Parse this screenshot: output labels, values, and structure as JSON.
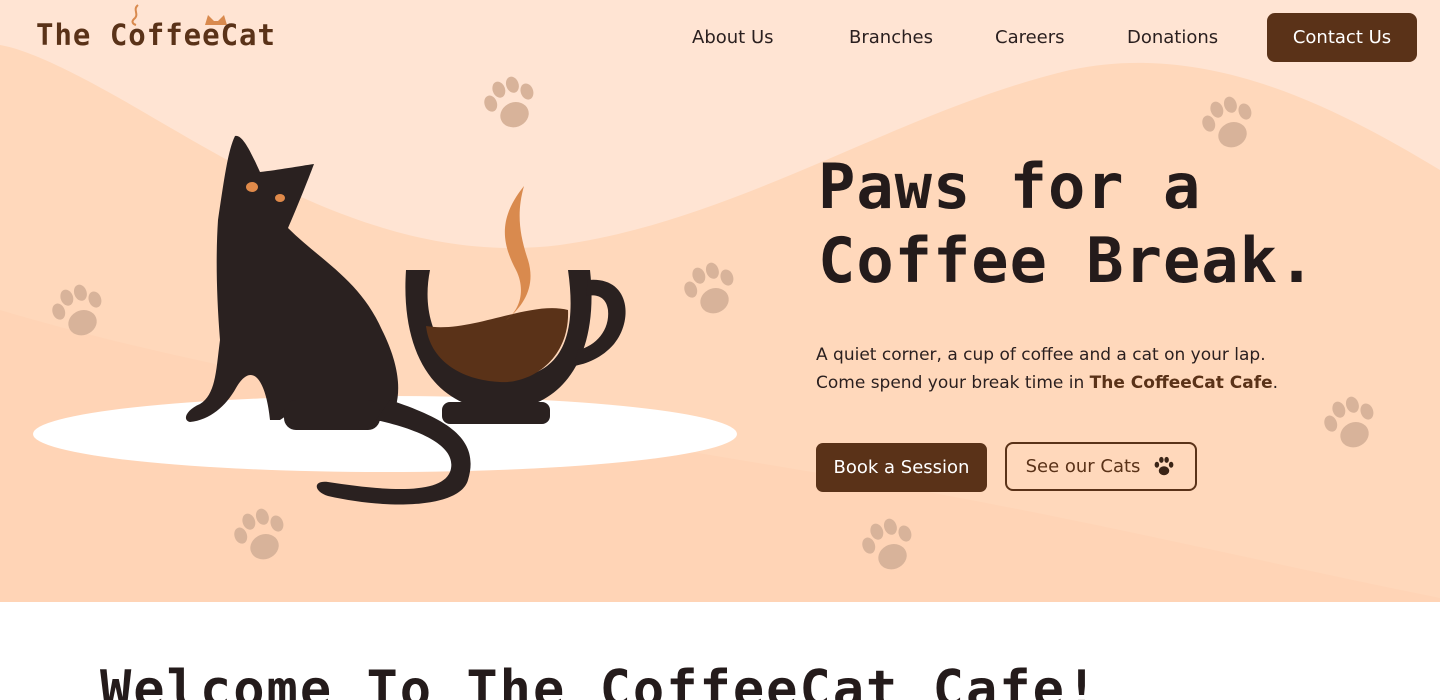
{
  "brand": {
    "logo_text": "The CoffeeCat",
    "brand_color": "#5a3218"
  },
  "nav": {
    "items": [
      {
        "label": "About Us"
      },
      {
        "label": "Branches"
      },
      {
        "label": "Careers"
      },
      {
        "label": "Donations"
      }
    ],
    "cta_label": "Contact Us"
  },
  "hero": {
    "title_line1": "Paws for a",
    "title_line2": "Coffee Break.",
    "desc_line1": "A quiet corner, a cup of coffee and a cat on your lap.",
    "desc_line2_prefix": "Come spend your break time in ",
    "desc_line2_brand": "The CoffeeCat Cafe",
    "desc_line2_suffix": ".",
    "primary_button": "Book a Session",
    "secondary_button": "See our Cats",
    "secondary_button_icon": "paw-icon",
    "background_color": "#ffd6b8"
  },
  "welcome": {
    "title": "Welcome To The CoffeeCat Cafe!"
  }
}
